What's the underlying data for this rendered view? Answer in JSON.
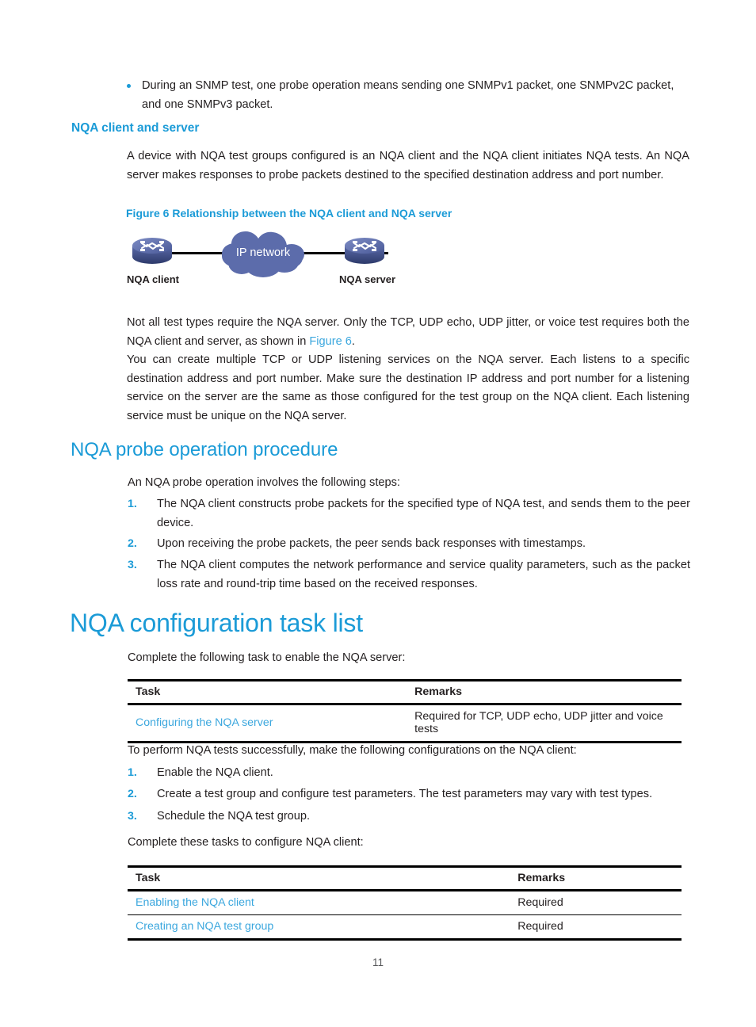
{
  "document": {
    "page_number": "11"
  },
  "bullet_note": {
    "marker": "bullet-dot",
    "text": "During an SNMP test, one probe operation means sending one SNMPv1 packet, one SNMPv2C packet, and one SNMPv3 packet."
  },
  "section_client_server": {
    "heading": "NQA client and server",
    "paragraph": "A device with NQA test groups configured is an NQA client and the NQA client initiates NQA tests. An NQA server makes responses to probe packets destined to the specified destination address and port number."
  },
  "figure": {
    "caption": "Figure 6 Relationship between the NQA client and NQA server",
    "left_device_label": "NQA client",
    "cloud_label": "IP network",
    "right_device_label": "NQA server",
    "cloud_color": "#5c6cab",
    "device_color": "#5c6cab",
    "link_color": "#000000"
  },
  "paragraphs_after_figure": {
    "p1_before_link": "Not all test types require the NQA server. Only the TCP, UDP echo, UDP jitter, or voice test requires both the NQA client and server, as shown in ",
    "p1_link": "Figure 6",
    "p1_after_link": ".",
    "p2": "You can create multiple TCP or UDP listening services on the NQA server. Each listens to a specific destination address and port number. Make sure the destination IP address and port number for a listening service on the server are the same as those configured for the test group on the NQA client. Each listening service must be unique on the NQA server."
  },
  "section_probe_procedure": {
    "heading": "NQA probe operation procedure",
    "intro": "An NQA probe operation involves the following steps:",
    "steps": [
      {
        "num": "1.",
        "text": "The NQA client constructs probe packets for the specified type of NQA test, and sends them to the peer device."
      },
      {
        "num": "2.",
        "text": "Upon receiving the probe packets, the peer sends back responses with timestamps."
      },
      {
        "num": "3.",
        "text": "The NQA client computes the network performance and service quality parameters, such as the packet loss rate and round-trip time based on the received responses."
      }
    ]
  },
  "section_task_list": {
    "heading": "NQA configuration task list",
    "intro_server": "Complete the following task to enable the NQA server:",
    "server_table": {
      "headers": [
        "Task",
        "Remarks"
      ],
      "rows": [
        {
          "task": "Configuring the NQA server",
          "remarks": "Required for TCP, UDP echo, UDP jitter and voice tests"
        }
      ]
    },
    "intro_client": "To perform NQA tests successfully, make the following configurations on the NQA client:",
    "client_steps": [
      {
        "num": "1.",
        "text": "Enable the NQA client."
      },
      {
        "num": "2.",
        "text": "Create a test group and configure test parameters. The test parameters may vary with test types."
      },
      {
        "num": "3.",
        "text": "Schedule the NQA test group."
      }
    ],
    "intro_client_table": "Complete these tasks to configure NQA client:",
    "client_table": {
      "headers": [
        "Task",
        "Remarks"
      ],
      "rows": [
        {
          "task": "Enabling the NQA client",
          "remarks": "Required"
        },
        {
          "task": "Creating an NQA test group",
          "remarks": "Required"
        }
      ]
    }
  },
  "colors": {
    "heading_blue": "#1b9bd7",
    "link_blue": "#3ba7de",
    "text_black": "#231f20"
  }
}
